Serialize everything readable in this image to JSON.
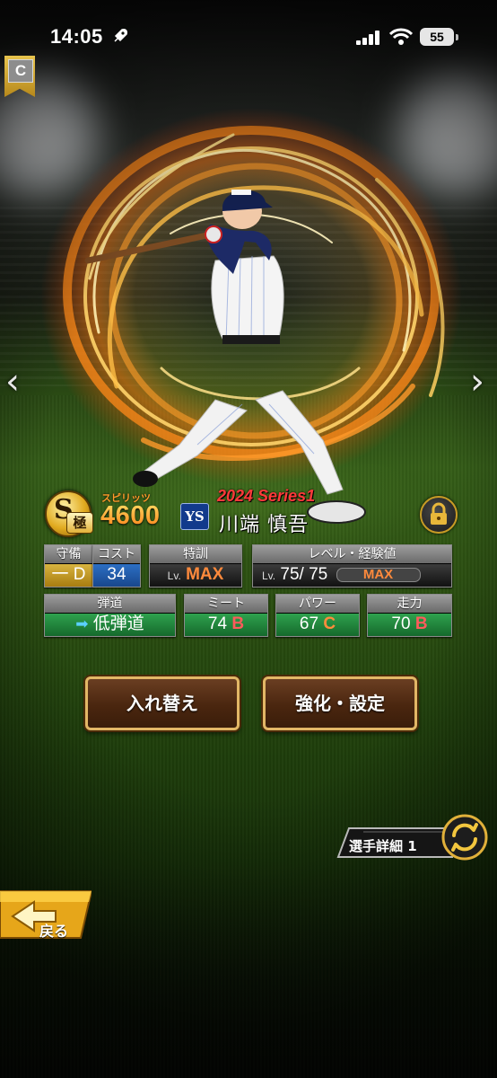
{
  "status_bar": {
    "time": "14:05",
    "battery": "55",
    "icons": [
      "rocket-icon",
      "signal-icon",
      "wifi-icon",
      "battery-icon"
    ]
  },
  "rank_badge": "C",
  "header": {
    "spirits_label": "スピリッツ",
    "spirits_value": "4600",
    "team_logo": "YS",
    "series": "2024 Series1",
    "player_name": "川端 慎吾"
  },
  "stats": {
    "position": {
      "label": "守備",
      "value": "一 D"
    },
    "cost": {
      "label": "コスト",
      "value": "34"
    },
    "training": {
      "label": "特訓",
      "lv": "Lv.",
      "value": "MAX"
    },
    "level": {
      "label": "レベル・経験値",
      "lv": "Lv.",
      "current": "75",
      "max": "/ 75",
      "exp": "MAX"
    },
    "trajectory": {
      "label": "弾道",
      "value": "低弾道"
    },
    "meet": {
      "label": "ミート",
      "value": "74",
      "grade": "B"
    },
    "power": {
      "label": "パワー",
      "value": "67",
      "grade": "C"
    },
    "speed": {
      "label": "走力",
      "value": "70",
      "grade": "B"
    }
  },
  "buttons": {
    "replace": "入れ替え",
    "enhance": "強化・設定"
  },
  "detail_toggle": "選手詳細 1",
  "back": "戻る",
  "colors": {
    "accent_gold": "#e2b766",
    "spirits_orange": "#ff9a2a",
    "series_red": "#ff3a3a",
    "grade_b": "#ff5b5b",
    "grade_c": "#ff8c3c"
  }
}
